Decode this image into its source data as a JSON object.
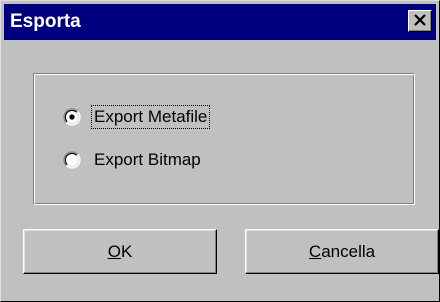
{
  "window": {
    "title": "Esporta",
    "close_icon": "close-icon",
    "title_bar_color": "#00007f",
    "face_color": "#c0c0c0"
  },
  "options": [
    {
      "label": "Export Metafile",
      "selected": true,
      "icon": "radio-selected-icon"
    },
    {
      "label": "Export Bitmap",
      "selected": false,
      "icon": "radio-unselected-icon"
    }
  ],
  "buttons": {
    "ok_label": "OK",
    "cancel_label": "Cancella"
  }
}
